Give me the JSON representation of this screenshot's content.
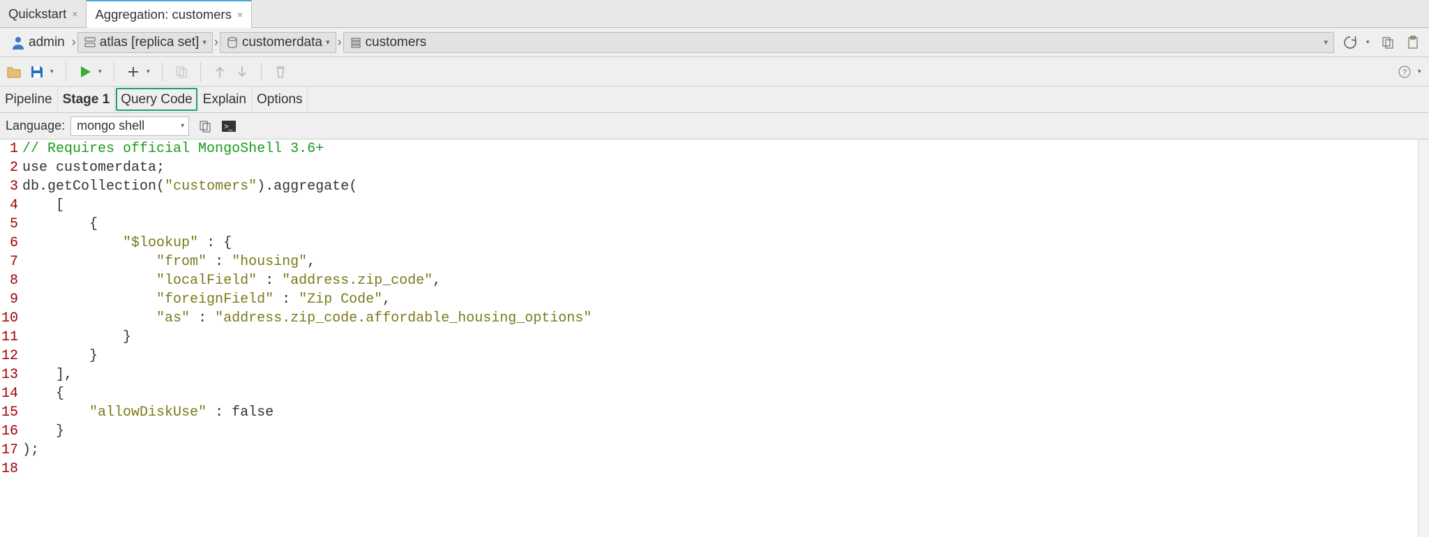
{
  "tabs": [
    {
      "label": "Quickstart"
    },
    {
      "label": "Aggregation: customers"
    }
  ],
  "breadcrumb": {
    "user": "admin",
    "cluster": "atlas [replica set]",
    "database": "customerdata",
    "collection": "customers"
  },
  "subtabs": {
    "pipeline": "Pipeline",
    "stage1": "Stage 1",
    "queryCode": "Query Code",
    "explain": "Explain",
    "options": "Options"
  },
  "language": {
    "label": "Language:",
    "selected": "mongo shell"
  },
  "code": {
    "lines": [
      {
        "n": "1",
        "segments": [
          {
            "cls": "tok-comment",
            "text": "// Requires official MongoShell 3.6+"
          }
        ]
      },
      {
        "n": "2",
        "segments": [
          {
            "cls": "tok-keyword",
            "text": "use customerdata;"
          }
        ]
      },
      {
        "n": "3",
        "segments": [
          {
            "cls": "tok-ident",
            "text": "db.getCollection("
          },
          {
            "cls": "tok-string",
            "text": "\"customers\""
          },
          {
            "cls": "tok-ident",
            "text": ").aggregate("
          }
        ]
      },
      {
        "n": "4",
        "segments": [
          {
            "cls": "tok-ident",
            "text": "    ["
          }
        ]
      },
      {
        "n": "5",
        "segments": [
          {
            "cls": "tok-ident",
            "text": "        {"
          }
        ]
      },
      {
        "n": "6",
        "segments": [
          {
            "cls": "tok-ident",
            "text": "            "
          },
          {
            "cls": "tok-string",
            "text": "\"$lookup\""
          },
          {
            "cls": "tok-ident",
            "text": " : {"
          }
        ]
      },
      {
        "n": "7",
        "segments": [
          {
            "cls": "tok-ident",
            "text": "                "
          },
          {
            "cls": "tok-string",
            "text": "\"from\""
          },
          {
            "cls": "tok-ident",
            "text": " : "
          },
          {
            "cls": "tok-string",
            "text": "\"housing\""
          },
          {
            "cls": "tok-ident",
            "text": ","
          }
        ]
      },
      {
        "n": "8",
        "segments": [
          {
            "cls": "tok-ident",
            "text": "                "
          },
          {
            "cls": "tok-string",
            "text": "\"localField\""
          },
          {
            "cls": "tok-ident",
            "text": " : "
          },
          {
            "cls": "tok-string",
            "text": "\"address.zip_code\""
          },
          {
            "cls": "tok-ident",
            "text": ","
          }
        ]
      },
      {
        "n": "9",
        "segments": [
          {
            "cls": "tok-ident",
            "text": "                "
          },
          {
            "cls": "tok-string",
            "text": "\"foreignField\""
          },
          {
            "cls": "tok-ident",
            "text": " : "
          },
          {
            "cls": "tok-string",
            "text": "\"Zip Code\""
          },
          {
            "cls": "tok-ident",
            "text": ","
          }
        ]
      },
      {
        "n": "10",
        "segments": [
          {
            "cls": "tok-ident",
            "text": "                "
          },
          {
            "cls": "tok-string",
            "text": "\"as\""
          },
          {
            "cls": "tok-ident",
            "text": " : "
          },
          {
            "cls": "tok-string",
            "text": "\"address.zip_code.affordable_housing_options\""
          }
        ]
      },
      {
        "n": "11",
        "segments": [
          {
            "cls": "tok-ident",
            "text": "            }"
          }
        ]
      },
      {
        "n": "12",
        "segments": [
          {
            "cls": "tok-ident",
            "text": "        }"
          }
        ]
      },
      {
        "n": "13",
        "segments": [
          {
            "cls": "tok-ident",
            "text": "    ], "
          }
        ]
      },
      {
        "n": "14",
        "segments": [
          {
            "cls": "tok-ident",
            "text": "    {"
          }
        ]
      },
      {
        "n": "15",
        "segments": [
          {
            "cls": "tok-ident",
            "text": "        "
          },
          {
            "cls": "tok-string",
            "text": "\"allowDiskUse\""
          },
          {
            "cls": "tok-ident",
            "text": " : "
          },
          {
            "cls": "tok-false",
            "text": "false"
          }
        ]
      },
      {
        "n": "16",
        "segments": [
          {
            "cls": "tok-ident",
            "text": "    }"
          }
        ]
      },
      {
        "n": "17",
        "segments": [
          {
            "cls": "tok-ident",
            "text": ");"
          }
        ]
      },
      {
        "n": "18",
        "segments": [
          {
            "cls": "tok-ident",
            "text": ""
          }
        ]
      }
    ]
  }
}
